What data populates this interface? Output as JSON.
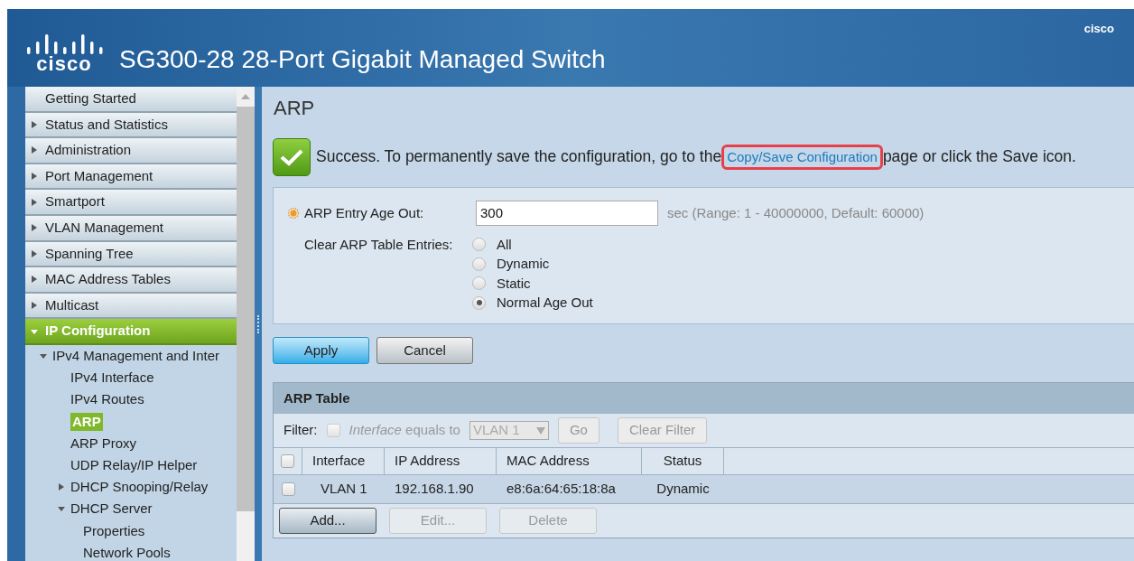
{
  "header": {
    "logo_text": "cisco",
    "title": "SG300-28 28-Port Gigabit Managed Switch",
    "corner_label": "cisco"
  },
  "sidebar": {
    "items": [
      {
        "label": "Getting Started",
        "expandable": false,
        "expanded": false,
        "selected": false
      },
      {
        "label": "Status and Statistics",
        "expandable": true,
        "expanded": false,
        "selected": false
      },
      {
        "label": "Administration",
        "expandable": true,
        "expanded": false,
        "selected": false
      },
      {
        "label": "Port Management",
        "expandable": true,
        "expanded": false,
        "selected": false
      },
      {
        "label": "Smartport",
        "expandable": true,
        "expanded": false,
        "selected": false
      },
      {
        "label": "VLAN Management",
        "expandable": true,
        "expanded": false,
        "selected": false
      },
      {
        "label": "Spanning Tree",
        "expandable": true,
        "expanded": false,
        "selected": false
      },
      {
        "label": "MAC Address Tables",
        "expandable": true,
        "expanded": false,
        "selected": false
      },
      {
        "label": "Multicast",
        "expandable": true,
        "expanded": false,
        "selected": false
      },
      {
        "label": "IP Configuration",
        "expanded": true,
        "selected": true,
        "children": [
          {
            "label": "IPv4 Management and Inter",
            "expanded": true,
            "selected": false,
            "children": [
              {
                "label": "IPv4 Interface",
                "expandable": false,
                "expanded": false,
                "selected": false
              },
              {
                "label": "IPv4 Routes",
                "expandable": false,
                "expanded": false,
                "selected": false
              },
              {
                "label": "ARP",
                "expandable": false,
                "expanded": false,
                "selected": true
              },
              {
                "label": "ARP Proxy",
                "expandable": false,
                "expanded": false,
                "selected": false
              },
              {
                "label": "UDP Relay/IP Helper",
                "expandable": false,
                "expanded": false,
                "selected": false
              },
              {
                "label": "DHCP Snooping/Relay",
                "expandable": true,
                "expanded": false,
                "selected": false
              },
              {
                "label": "DHCP Server",
                "expanded": true,
                "selected": false,
                "children": [
                  {
                    "label": "Properties",
                    "expandable": false,
                    "expanded": false,
                    "selected": false
                  },
                  {
                    "label": "Network Pools",
                    "expandable": false,
                    "expanded": false,
                    "selected": false
                  }
                ]
              }
            ]
          }
        ]
      }
    ]
  },
  "page_title": "ARP",
  "message": {
    "before": "Success. To permanently save the configuration, go to the",
    "link": "Copy/Save Configuration",
    "after": "page or click the Save icon."
  },
  "form": {
    "age_out": {
      "label": "ARP Entry Age Out:",
      "value": "300",
      "hint": "sec (Range: 1 - 40000000, Default: 60000)"
    },
    "clear_entries": {
      "label": "Clear ARP Table Entries:",
      "options": [
        {
          "label": "All",
          "selected": false
        },
        {
          "label": "Dynamic",
          "selected": false
        },
        {
          "label": "Static",
          "selected": false
        },
        {
          "label": "Normal Age Out",
          "selected": true
        }
      ]
    }
  },
  "form_buttons": [
    {
      "label": "Apply",
      "primary": true
    },
    {
      "label": "Cancel",
      "primary": false
    }
  ],
  "arp_table": {
    "title": "ARP Table",
    "filter": {
      "label": "Filter:",
      "checked": false,
      "condition": "*Interface* equals to",
      "select_value": "VLAN 1",
      "select_disabled": true,
      "buttons": [
        {
          "label": "Go",
          "disabled": true
        },
        {
          "label": "Clear Filter",
          "disabled": true
        }
      ]
    },
    "all_checked": false,
    "columns": [
      "Interface",
      "IP Address",
      "MAC Address",
      "Status"
    ],
    "rows": [
      {
        "checked": false,
        "cells": [
          "VLAN 1",
          "192.168.1.90",
          "e8:6a:64:65:18:8a",
          "Dynamic"
        ]
      }
    ],
    "buttons": [
      {
        "label": "Add...",
        "disabled": false
      },
      {
        "label": "Edit...",
        "disabled": true
      },
      {
        "label": "Delete",
        "disabled": true
      }
    ]
  }
}
